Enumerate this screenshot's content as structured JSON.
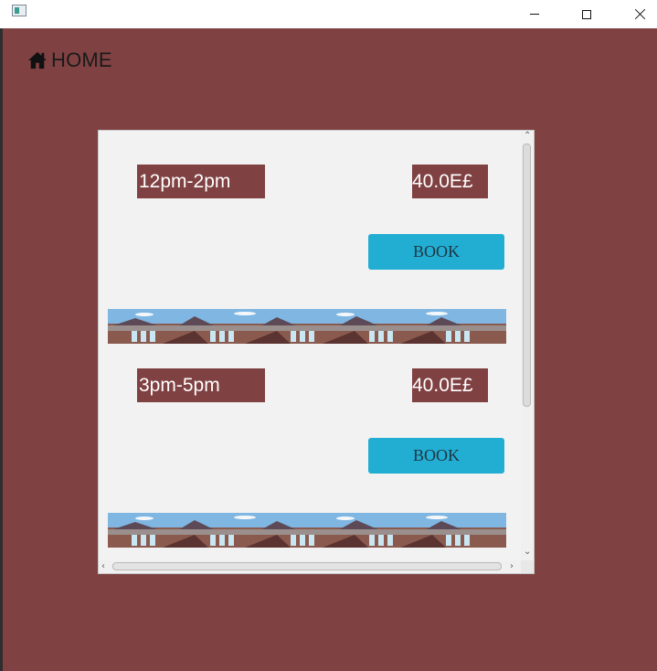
{
  "window": {
    "controls": {
      "minimize_icon": "minimize-icon",
      "maximize_icon": "maximize-icon",
      "close_icon": "close-icon"
    }
  },
  "nav": {
    "home_label": "HOME",
    "home_icon": "home-icon"
  },
  "slots": [
    {
      "time": "12pm-2pm",
      "price": "40.0E£",
      "button": "BOOK"
    },
    {
      "time": "3pm-5pm",
      "price": "40.0E£",
      "button": "BOOK"
    }
  ],
  "colors": {
    "background": "#804142",
    "panel": "#f2f2f2",
    "button": "#22aed3",
    "field": "#804142"
  }
}
